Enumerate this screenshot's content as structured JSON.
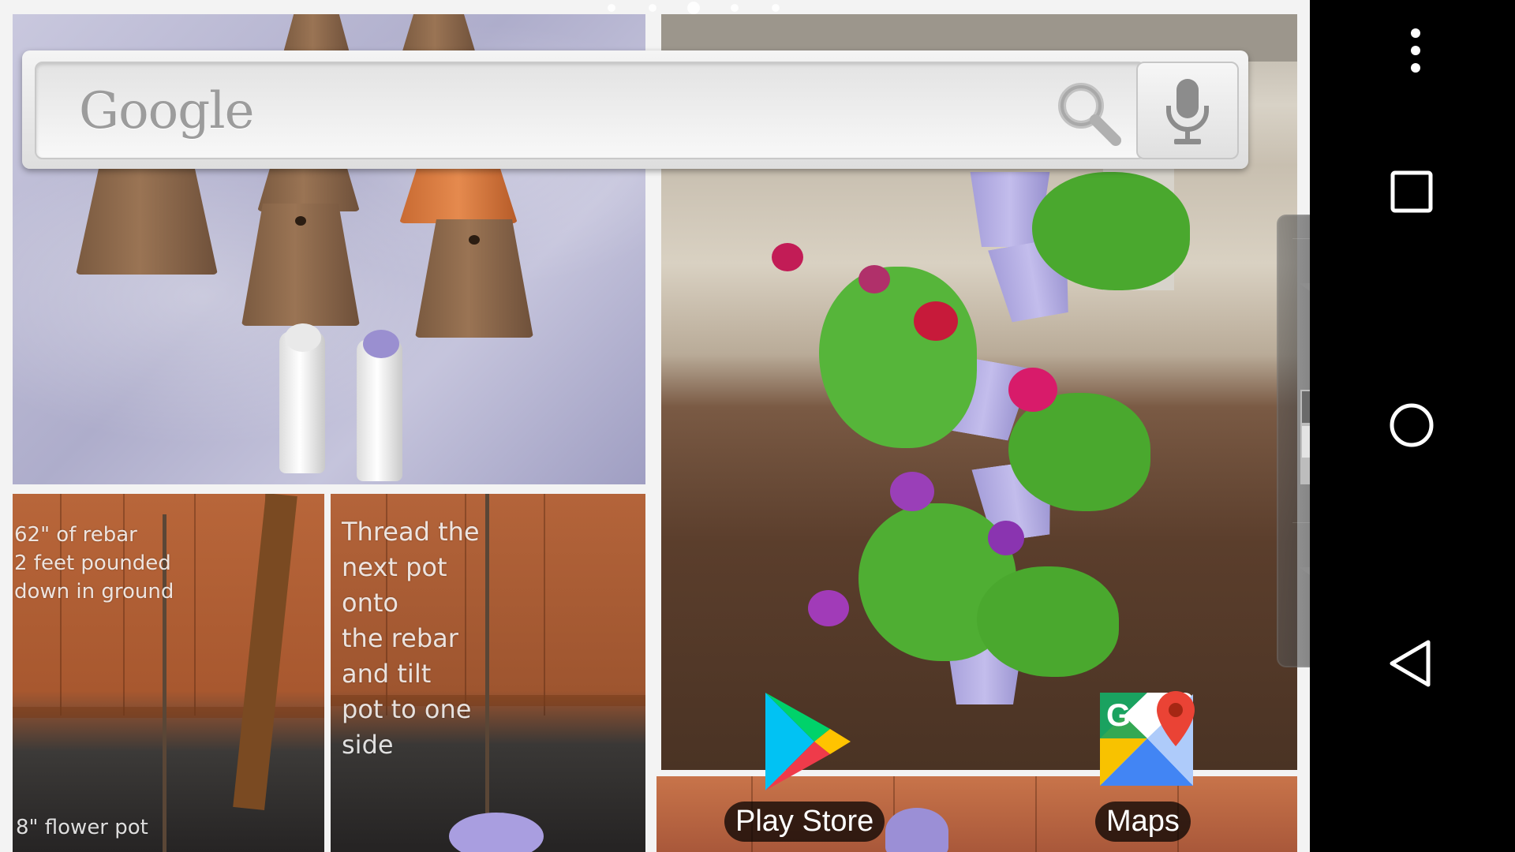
{
  "search_widget": {
    "logo_text": "Google",
    "search_icon": "search-icon",
    "voice_icon": "microphone-icon"
  },
  "wallpaper": {
    "pots_panel_icon": "photo",
    "rebar_caption": "62\" of rebar\n2 feet pounded\ndown in ground",
    "rebar_bottom_caption": "8\" flower pot",
    "thread_caption": "Thread the\nnext pot\nonto\nthe rebar\nand tilt\npot to one\nside"
  },
  "page_indicator": {
    "count": 5,
    "active_index": 2
  },
  "apps": [
    {
      "label": "Play Store",
      "icon": "play-store-icon"
    },
    {
      "label": "Maps",
      "icon": "google-maps-icon"
    }
  ],
  "dock": {
    "items": [
      "star-icon",
      "app-grid-icon",
      "star-icon"
    ]
  },
  "navigation": {
    "overflow": "overflow-menu-icon",
    "recents": "recents-icon",
    "home": "home-icon",
    "back": "back-icon"
  },
  "colors": {
    "lavender": "#a9a2dc",
    "fence": "#b4643a",
    "nav_bar": "#000000"
  }
}
